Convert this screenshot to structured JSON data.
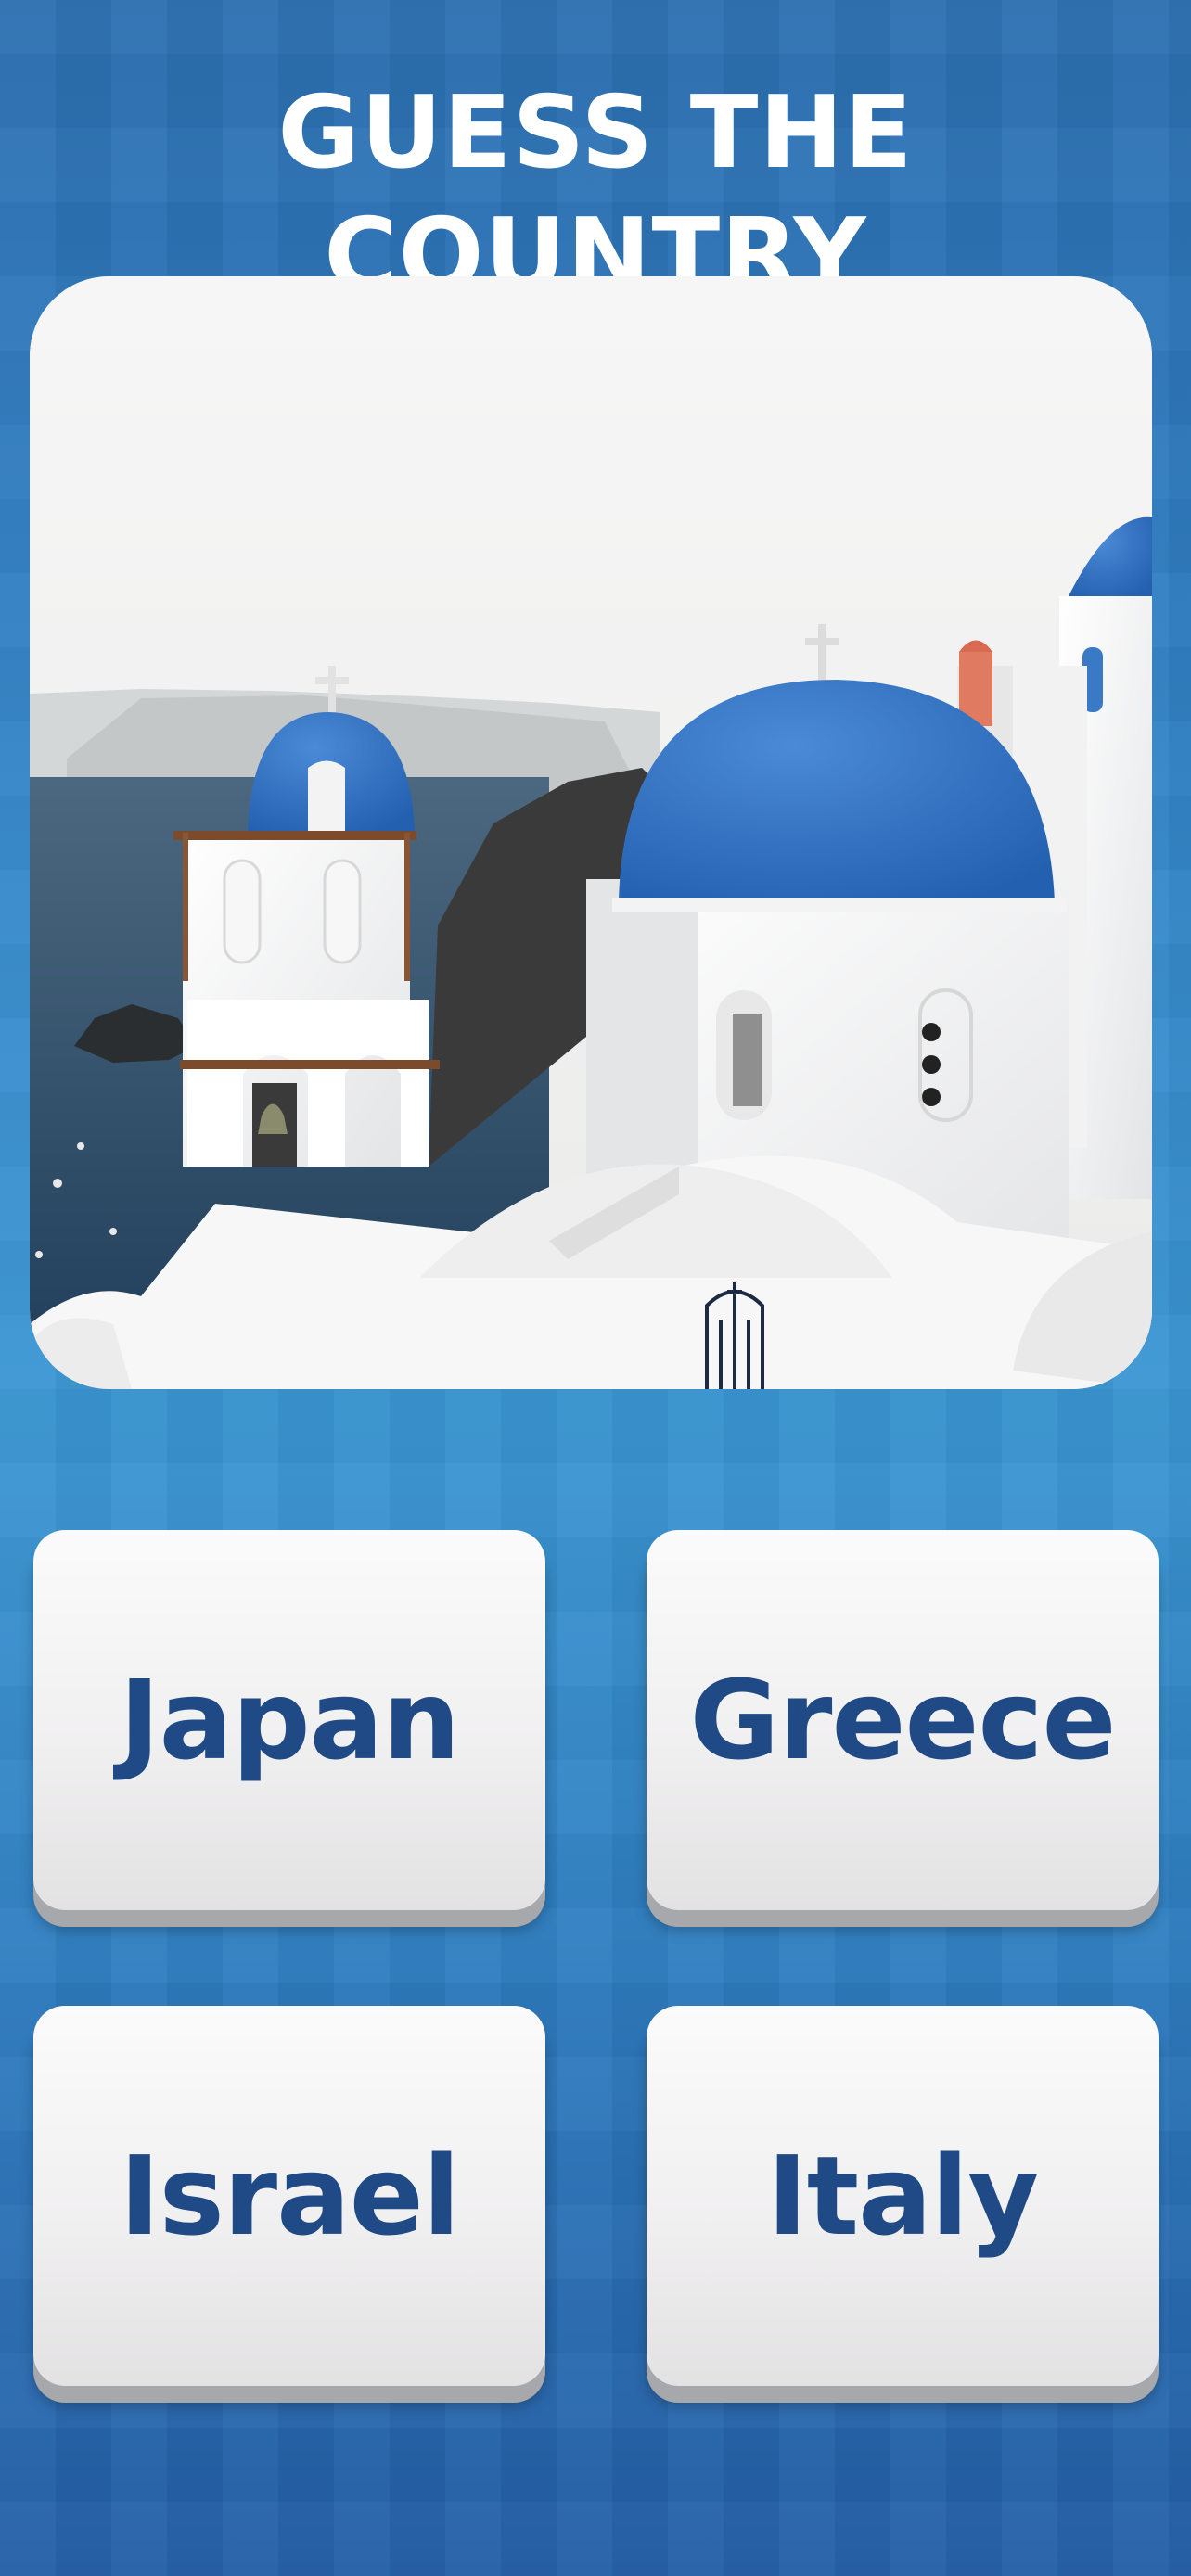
{
  "title": "GUESS THE COUNTRY",
  "question_image": {
    "subject": "whitewashed churches with blue domes overlooking the sea"
  },
  "answers": [
    {
      "label": "Japan"
    },
    {
      "label": "Greece"
    },
    {
      "label": "Israel"
    },
    {
      "label": "Italy"
    }
  ],
  "colors": {
    "background": "#2f7cc0",
    "title_text": "#ffffff",
    "answer_text": "#1f4a86",
    "button_face": "#f3f2f3",
    "dome_blue": "#2f6fc2"
  }
}
